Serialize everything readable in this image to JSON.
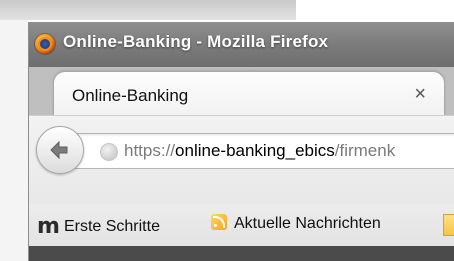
{
  "window": {
    "title": "Online-Banking - Mozilla Firefox"
  },
  "tab": {
    "label": "Online-Banking",
    "close_symbol": "×"
  },
  "urlbar": {
    "scheme": "https://",
    "host": "online-banking_ebics",
    "path": "/firmenk"
  },
  "bookmarks": {
    "items": [
      {
        "label": "Erste Schritte",
        "icon": "m-icon"
      },
      {
        "label": "Aktuelle Nachrichten",
        "icon": "rss-icon"
      }
    ]
  },
  "icons": {
    "app": "firefox-icon",
    "back": "back-arrow-icon",
    "site": "site-identity-icon",
    "folder": "bookmark-folder-icon"
  },
  "colors": {
    "titlebar": "#7a7a7a",
    "tab": "#f8f8f8",
    "toolbar": "#ececec"
  }
}
